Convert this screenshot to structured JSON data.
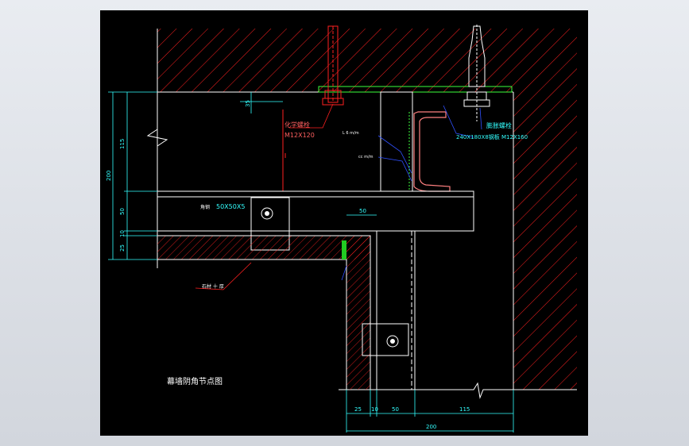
{
  "drawing": {
    "title": "幕墙阴角节点图",
    "labels": {
      "anchor_bolt": "化学螺栓",
      "anchor_bolt_size": "M12X120",
      "expansion_bolt": "膨胀螺栓",
      "plate_and_bolt": "240X180X8钢板 M12X160",
      "angle_steel": "角钢",
      "angle_size": "50X50X5",
      "stone": "石材 十 厚",
      "small_note_1": "L 6 m/m",
      "small_note_2": "cc m/m"
    },
    "dimensions": {
      "left": [
        "115",
        "200",
        "50",
        "10",
        "25"
      ],
      "top_small": "35",
      "mid": "50",
      "bottom": [
        "25",
        "10",
        "50",
        "115"
      ],
      "bottom_total": "200"
    }
  }
}
